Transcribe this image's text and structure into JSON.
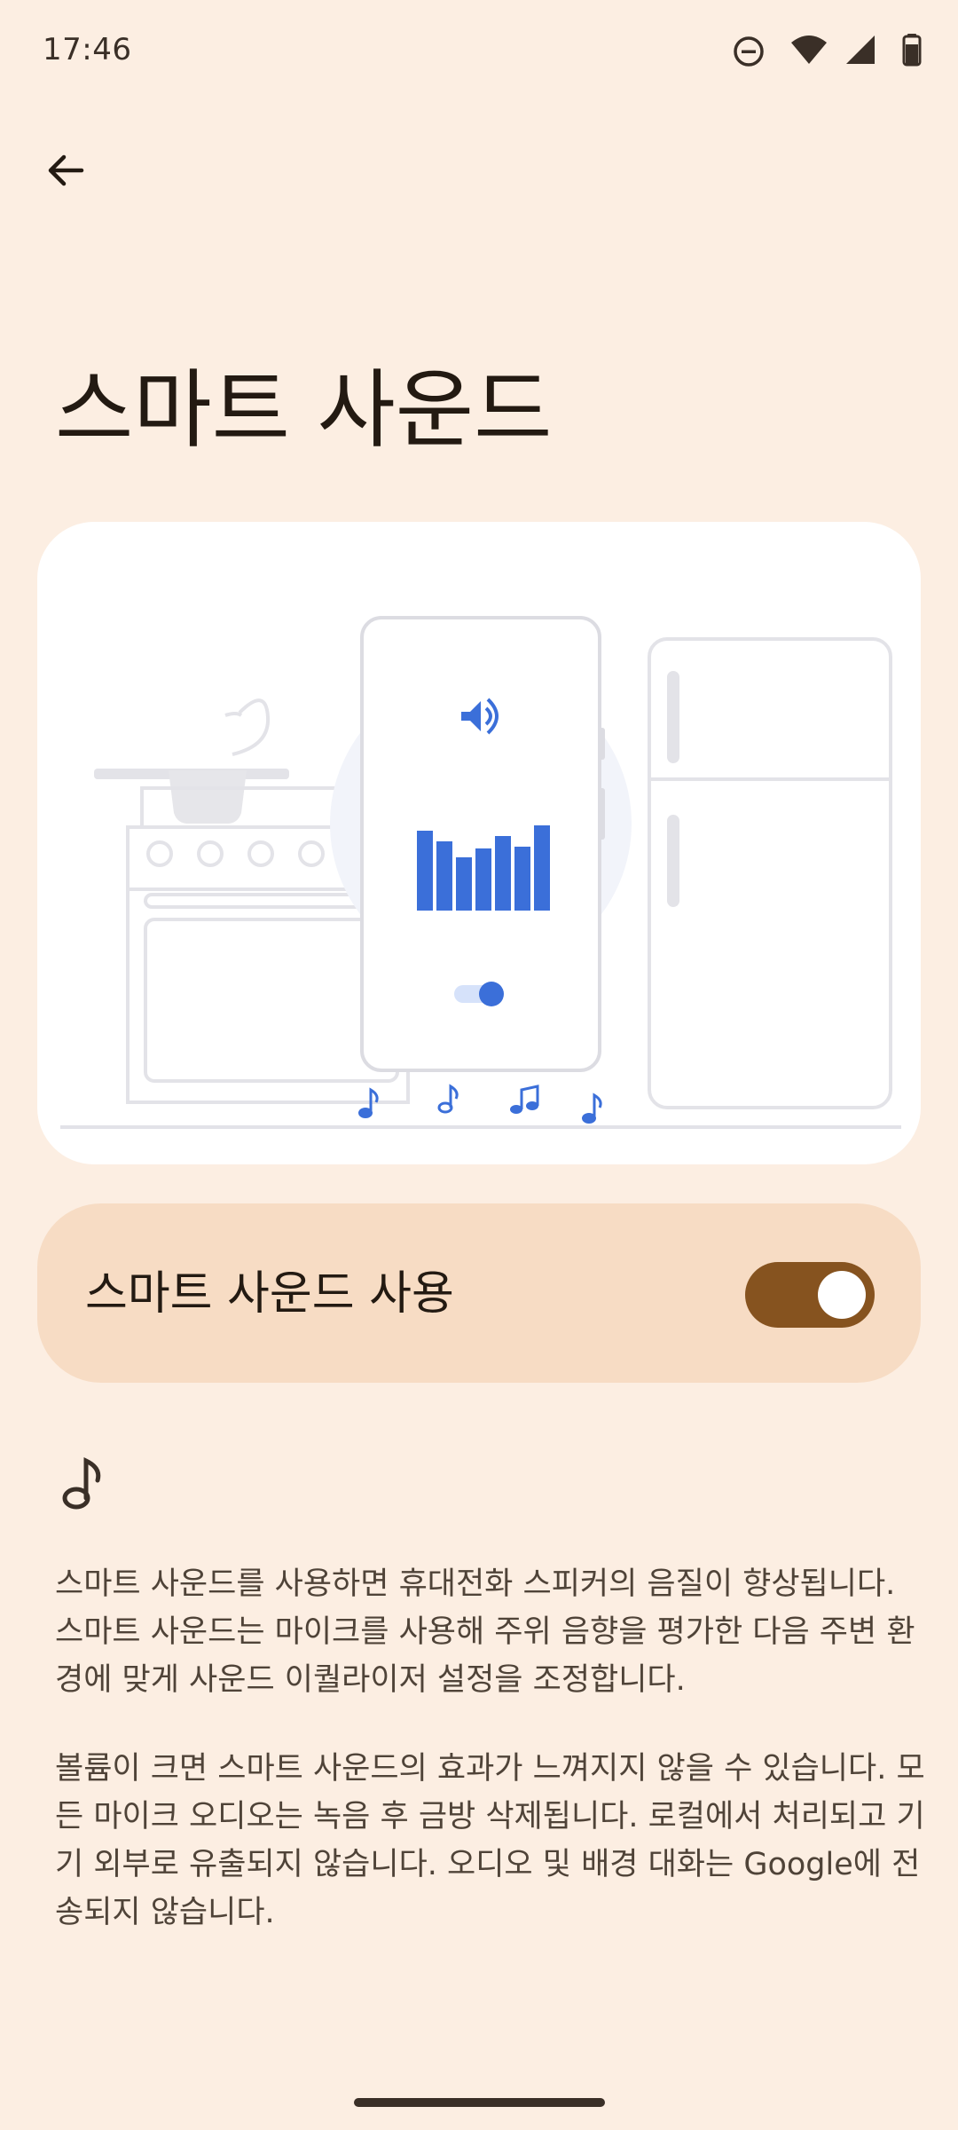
{
  "status_bar": {
    "time": "17:46",
    "icons": [
      "do-not-disturb-icon",
      "wifi-icon",
      "cell-signal-icon",
      "battery-icon"
    ]
  },
  "header": {
    "back_icon": "arrow-back-icon"
  },
  "title": "스마트 사운드",
  "illustration": {
    "phone_icon": "speaker-volume-icon"
  },
  "toggle": {
    "label": "스마트 사운드 사용",
    "checked": true
  },
  "info_icon": "music-note-icon",
  "description": {
    "paragraph1": "스마트 사운드를 사용하면 휴대전화 스피커의 음질이 향상됩니다. 스마트 사운드는 마이크를 사용해 주위 음향을 평가한 다음 주변 환경에 맞게 사운드 이퀄라이저 설정을 조정합니다.",
    "paragraph2": "볼륨이 크면 스마트 사운드의 효과가 느껴지지 않을 수 있습니다. 모든 마이크 오디오는 녹음 후 금방 삭제됩니다. 로컬에서 처리되고 기기 외부로 유출되지 않습니다. 오디오 및 배경 대화는 Google에 전송되지 않습니다."
  },
  "colors": {
    "background": "#FCEEE2",
    "toggle_card": "#F7DCC4",
    "switch_on": "#86531F",
    "accent_blue": "#3B6FD9"
  }
}
